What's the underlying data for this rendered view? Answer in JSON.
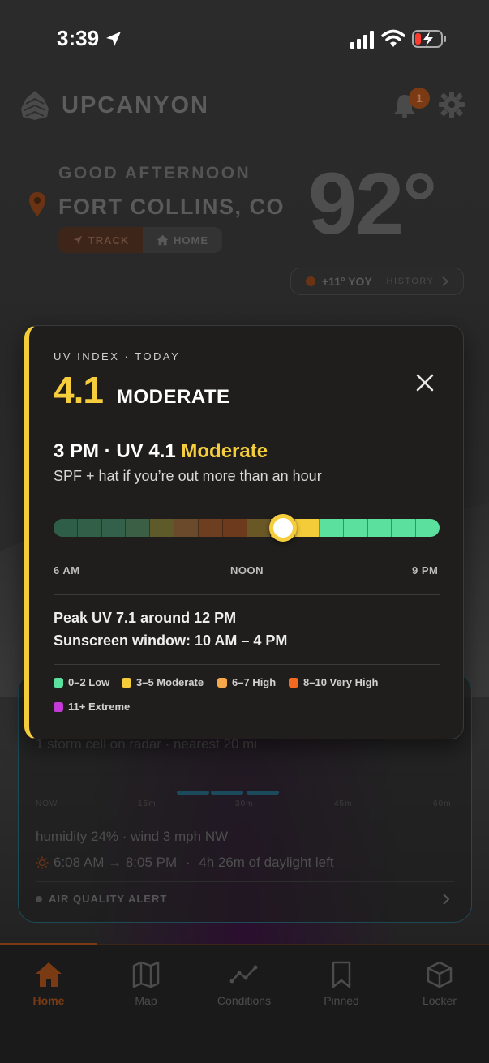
{
  "status_bar": {
    "time": "3:39"
  },
  "app": {
    "name": "UPCANYON",
    "notification_count": "1",
    "greeting": "GOOD AFTERNOON",
    "location": "FORT COLLINS, CO",
    "mode_track": "TRACK",
    "mode_home": "HOME",
    "temperature": "92°",
    "yoy_value": "+11° YOY",
    "yoy_history": "· HISTORY"
  },
  "uv_popup": {
    "overline": "UV INDEX · TODAY",
    "value": "4.1",
    "level": "MODERATE",
    "hour_prefix": "3 PM · UV 4.1",
    "hour_level": "Moderate",
    "advice": "SPF + hat if you’re out more than an hour",
    "current_uv": 4.1,
    "axis": {
      "start": "6 AM",
      "mid": "NOON",
      "end": "9 PM"
    },
    "peak_line": "Peak UV 7.1 around 12 PM",
    "window_line": "Sunscreen window: 10 AM – 4 PM",
    "hour_segment_colors": [
      "#2f5e48",
      "#315f48",
      "#33604a",
      "#3a5f44",
      "#5f5a2a",
      "#6a4a2a",
      "#6d3e20",
      "#6e3a1d",
      "#6a5726",
      "#f2c43a",
      "#f4cc3a",
      "#5be09e",
      "#5be09e",
      "#5be09e",
      "#5be09e",
      "#5be09e"
    ],
    "legend": [
      {
        "label": "0–2 Low",
        "color": "#5be09e"
      },
      {
        "label": "3–5 Moderate",
        "color": "#f4cc3a"
      },
      {
        "label": "6–7 High",
        "color": "#f7a84a"
      },
      {
        "label": "8–10 Very High",
        "color": "#f26a22"
      },
      {
        "label": "11+ Extreme",
        "color": "#c43ad6"
      }
    ],
    "accent_color": "#f4cc3a"
  },
  "background_card": {
    "storm": "1 storm cell on radar · nearest 20 mi",
    "timeline": [
      "NOW",
      "15m",
      "30m",
      "45m",
      "60m"
    ],
    "humidity": "humidity 24% · wind 3 mph NW",
    "sun_times": "6:08 AM → 8:05 PM",
    "daylight": "4h 26m of daylight left",
    "air_quality": "AIR QUALITY ALERT"
  },
  "tabs": [
    {
      "label": "Home",
      "icon": "home-icon",
      "active": true
    },
    {
      "label": "Map",
      "icon": "map-icon",
      "active": false
    },
    {
      "label": "Conditions",
      "icon": "conditions-icon",
      "active": false
    },
    {
      "label": "Pinned",
      "icon": "bookmark-icon",
      "active": false
    },
    {
      "label": "Locker",
      "icon": "box-icon",
      "active": false
    }
  ]
}
